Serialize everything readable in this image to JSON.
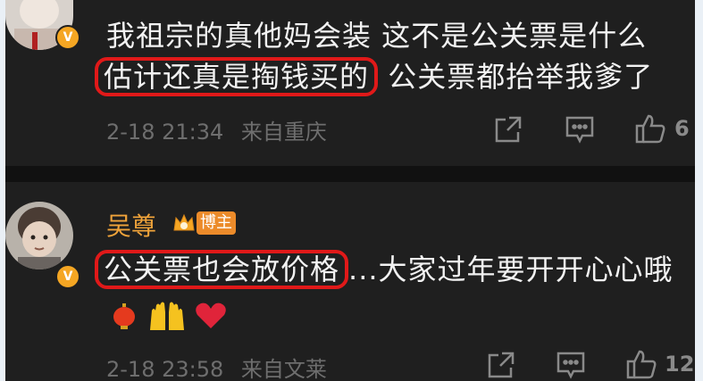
{
  "comment1": {
    "line1": "我祖宗的真他妈会装 这不是公关票是什么",
    "line2_highlight": "估计还真是掏钱买的",
    "line2_rest": "公关票都抬举我爹了",
    "time": "2-18 21:34",
    "source": "来自重庆",
    "likes": "6"
  },
  "comment2": {
    "username": "吴尊",
    "badge": "博主",
    "text_highlight": "公关票也会放价格",
    "text_rest": "...大家过年要开开心心哦",
    "time": "2-18 23:58",
    "source": "来自文莱",
    "likes": "12"
  },
  "colors": {
    "background": "#1f1f1f",
    "highlight_border": "#e01919",
    "username": "#f0a33a",
    "verified": "#f5a623"
  },
  "icons": [
    "share-icon",
    "comment-icon",
    "like-icon",
    "verified-icon",
    "crown-icon",
    "lantern-emoji",
    "raised-hands-emoji",
    "heart-emoji"
  ]
}
